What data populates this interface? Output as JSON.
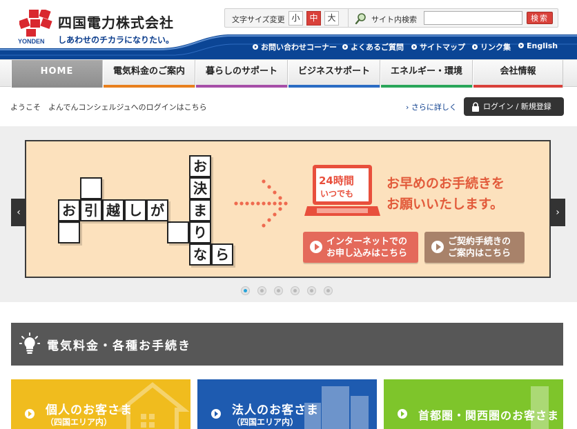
{
  "header": {
    "company_name": "四国電力株式会社",
    "tagline": "しあわせのチカラになりたい。",
    "brand": "YONDEN",
    "font_size": {
      "label": "文字サイズ変更",
      "options": [
        "小",
        "中",
        "大"
      ],
      "selected": "中"
    },
    "search": {
      "label": "サイト内検索",
      "value": "",
      "button": "検索"
    },
    "sublinks": [
      "お問い合わせコーナー",
      "よくあるご質問",
      "サイトマップ",
      "リンク集",
      "English"
    ]
  },
  "nav": {
    "items": [
      {
        "label": "HOME",
        "color": "#8d8d8d"
      },
      {
        "label": "電気料金のご案内",
        "color": "#e8801e"
      },
      {
        "label": "暮らしのサポート",
        "color": "#a64ea8"
      },
      {
        "label": "ビジネスサポート",
        "color": "#2b6cc4"
      },
      {
        "label": "エネルギー・環境",
        "color": "#2aa65a"
      },
      {
        "label": "会社情報",
        "color": "#d9413a"
      }
    ]
  },
  "welcome": {
    "text": "ようこそ　よんでんコンシェルジュへのログインはこちら",
    "more_link": "さらに詳しく",
    "login_button": "ログイン / 新規登録"
  },
  "hero": {
    "puzzle_row": [
      "お",
      "引",
      "越",
      "し",
      "が"
    ],
    "puzzle_col": [
      "お",
      "決",
      "ま",
      "り",
      "な",
      "ら"
    ],
    "badge_line1": "24時間",
    "badge_line2": "いつでも",
    "message_line1": "お早めのお手続きを",
    "message_line2": "お願いいたします。",
    "cta_internet_line1": "インターネットでの",
    "cta_internet_line2": "お申し込みはこちら",
    "cta_contract_line1": "ご契約手続きの",
    "cta_contract_line2": "ご案内はこちら",
    "prev": "‹",
    "next": "›",
    "slide_count": 6,
    "active_slide": 1
  },
  "section": {
    "title": "電気料金・各種お手続き",
    "cards": [
      {
        "title": "個人のお客さま",
        "sub": "（四国エリア内）",
        "color": "#f0bc1e"
      },
      {
        "title": "法人のお客さま",
        "sub": "（四国エリア内）",
        "color": "#1e5bb0"
      },
      {
        "title": "首都圏・関西圏のお客さま",
        "sub": "",
        "color": "#7ec52b"
      }
    ]
  }
}
